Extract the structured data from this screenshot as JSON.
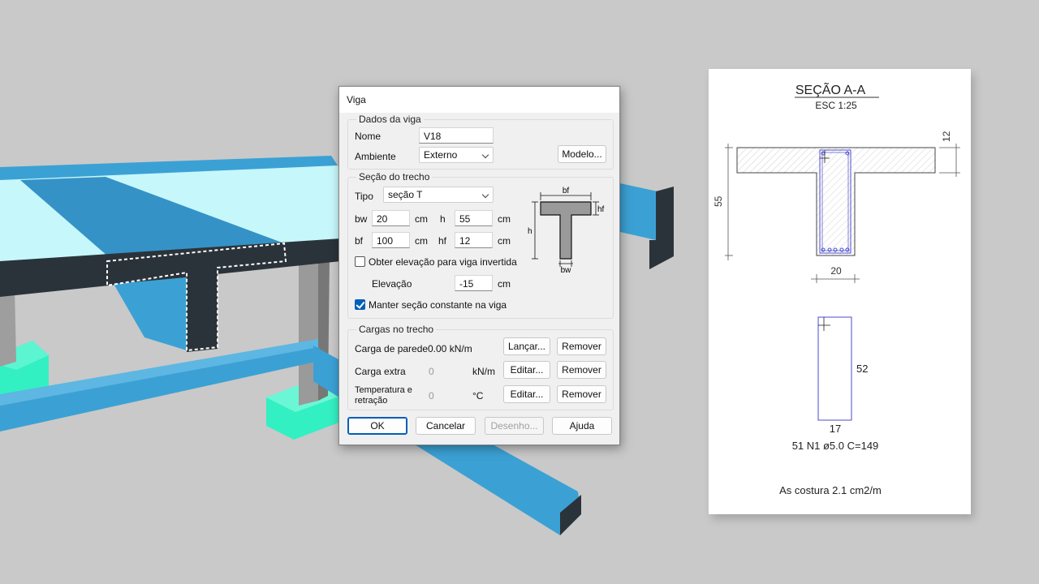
{
  "dialog": {
    "title": "Viga",
    "dados": {
      "title": "Dados da viga",
      "nome_label": "Nome",
      "nome_value": "V18",
      "ambiente_label": "Ambiente",
      "ambiente_value": "Externo",
      "modelo_button": "Modelo..."
    },
    "secao": {
      "title": "Seção do trecho",
      "tipo_label": "Tipo",
      "tipo_value": "seção T",
      "bw_label": "bw",
      "bw_value": "20",
      "h_label": "h",
      "h_value": "55",
      "bf_label": "bf",
      "bf_value": "100",
      "hf_label": "hf",
      "hf_value": "12",
      "unit": "cm",
      "obter_elevacao_label": "Obter elevação para viga invertida",
      "obter_elevacao_checked": false,
      "elevacao_label": "Elevação",
      "elevacao_value": "-15",
      "manter_secao_label": "Manter seção constante na viga",
      "manter_secao_checked": true,
      "diagram": {
        "bf": "bf",
        "hf": "hf",
        "h": "h",
        "bw": "bw"
      }
    },
    "cargas": {
      "title": "Cargas no trecho",
      "parede_label": "Carga de parede",
      "parede_value": "0.00 kN/m",
      "lancar_button": "Lançar...",
      "extra_label": "Carga extra",
      "extra_value": "0",
      "extra_unit": "kN/m",
      "temp_label_1": "Temperatura e",
      "temp_label_2": "retração",
      "temp_value": "0",
      "temp_unit": "°C",
      "editar_button": "Editar...",
      "remover_button": "Remover"
    },
    "buttons": {
      "ok": "OK",
      "cancelar": "Cancelar",
      "desenho": "Desenho...",
      "ajuda": "Ajuda"
    }
  },
  "drawing": {
    "title": "SEÇÃO A-A",
    "scale": "ESC 1:25",
    "dim_height": "55",
    "dim_flange": "12",
    "dim_width": "20",
    "stirrup_height": "52",
    "stirrup_width": "17",
    "stirrup_spec": "51 N1 ø5.0 C=149",
    "footer": "As costura 2.1 cm2/m"
  },
  "colors": {
    "background": "#c9c9c9",
    "slab_top": "#c6f7fb",
    "beam_blue": "#3ba1d4",
    "beam_dark": "#2b333a",
    "footing": "#33f0c3",
    "column_gray": "#9a9a9a",
    "accent": "#005fb8"
  }
}
